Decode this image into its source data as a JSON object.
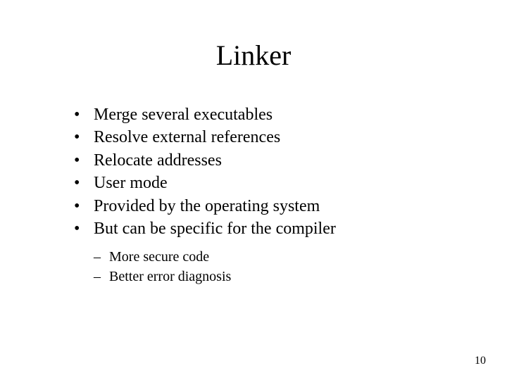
{
  "title": "Linker",
  "bullets": [
    "Merge several executables",
    "Resolve external references",
    "Relocate addresses",
    "User mode",
    "Provided by the operating system",
    "But can be specific for the compiler"
  ],
  "sub_bullets": [
    "More secure code",
    "Better error diagnosis"
  ],
  "page_number": "10"
}
